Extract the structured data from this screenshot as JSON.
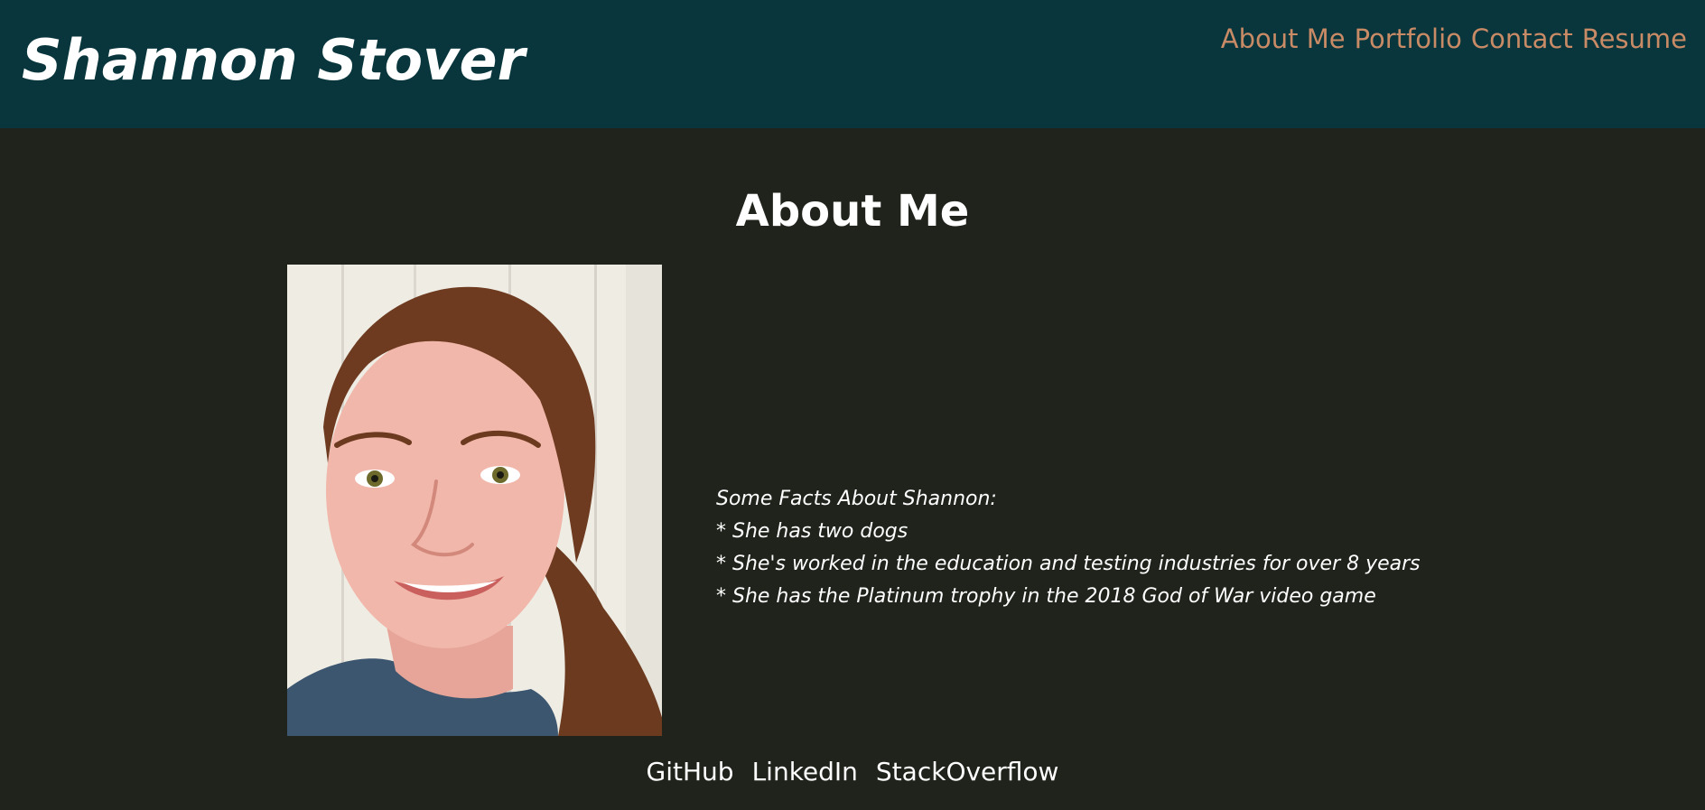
{
  "header": {
    "title": "Shannon Stover",
    "nav": [
      "About Me",
      "Portfolio",
      "Contact",
      "Resume"
    ]
  },
  "main": {
    "heading": "About Me",
    "facts_title": "Some Facts About Shannon:",
    "facts": [
      "* She has two dogs",
      "* She's worked in the education and testing industries for over 8 years",
      "* She has the Platinum trophy in the 2018 God of War video game"
    ]
  },
  "footer": {
    "links": [
      "GitHub",
      "LinkedIn",
      "StackOverflow"
    ]
  },
  "colors": {
    "header_bg": "#08363c",
    "page_bg": "#1f231b",
    "nav_link": "#c98a66",
    "text": "#ffffff"
  }
}
